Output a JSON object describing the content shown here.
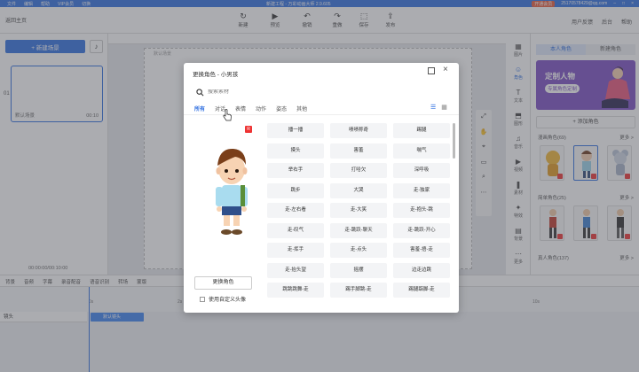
{
  "titlebar": {
    "menu": [
      "文件",
      "编辑",
      "帮助",
      "VIP会员",
      "切换"
    ],
    "title": "新建工程 - 万彩动画大师 2.9.605",
    "vip": "开通会员",
    "account": "25170578429@qq.com"
  },
  "toolbar": {
    "home": "返回主页",
    "buttons": [
      {
        "icon": "↻",
        "label": "新建"
      },
      {
        "icon": "▶",
        "label": "预览"
      },
      {
        "icon": "↶",
        "label": "撤销"
      },
      {
        "icon": "↷",
        "label": "重做"
      },
      {
        "icon": "⬚",
        "label": "保存"
      },
      {
        "icon": "⇪",
        "label": "发布"
      }
    ],
    "right": [
      "用户反馈",
      "后台",
      "帮助"
    ]
  },
  "leftpanel": {
    "new_scene": "+ 新建场景",
    "music_icon": "♪",
    "scene_index": "01",
    "scene_name": "默认场景",
    "scene_duration": "00:10",
    "timecode": "00:00:00/00:10:00"
  },
  "stage": {
    "label": "默认场景"
  },
  "sidetools": [
    "⤢",
    "✋",
    "⌖",
    "▭",
    "⌕",
    "⋯"
  ],
  "rail": [
    {
      "icon": "▦",
      "label": "图片"
    },
    {
      "icon": "☺",
      "label": "角色"
    },
    {
      "icon": "T",
      "label": "文本"
    },
    {
      "icon": "⬒",
      "label": "图形"
    },
    {
      "icon": "♫",
      "label": "音乐"
    },
    {
      "icon": "▶",
      "label": "视频"
    },
    {
      "icon": "❚",
      "label": "素材"
    },
    {
      "icon": "✦",
      "label": "特效"
    },
    {
      "icon": "▤",
      "label": "背景"
    },
    {
      "icon": "⋯",
      "label": "更多"
    }
  ],
  "rightpanel": {
    "tabs": [
      "本人角色",
      "新建角色"
    ],
    "banner_title": "定制人物",
    "banner_sub": "专属角色定制",
    "add_role": "+ 添加角色",
    "section1": "漫画角色(69)",
    "section2": "简单角色(25)",
    "section3": "真人角色(137)",
    "more": "更多 >"
  },
  "timeline": {
    "tools": [
      "背景",
      "音频",
      "字幕",
      "录音配音",
      "语音识别",
      "转场",
      "蒙版"
    ],
    "track_name": "镜头",
    "clip_label": "默认镜头",
    "ruler": [
      "0s",
      "2s",
      "4s",
      "6s",
      "8s",
      "10s"
    ]
  },
  "modal": {
    "title": "更换角色 - 小男孩",
    "search_placeholder": "搜索素材",
    "tabs": [
      "所有",
      "对话",
      "表情",
      "动作",
      "姿态",
      "其他"
    ],
    "badge": "R",
    "replace_button": "更换角色",
    "checkbox_label": "使用自定义头像",
    "actions": [
      "播一播",
      "啧啧称奇",
      "踢腿",
      "摸头",
      "害羞",
      "喘气",
      "举右手",
      "打哈欠",
      "深呼吸",
      "跳步",
      "大哭",
      "走-独家",
      "走-左右看",
      "走-大笑",
      "走-抱头-跳",
      "走-叹气",
      "走-跳跃-聊天",
      "走-跳跃-开心",
      "走-挥手",
      "走-点头",
      "害羞-捂-走",
      "走-抬头望",
      "摇摆",
      "边走边跳",
      "跳跳跳舞-走",
      "踢手脚跳-走",
      "踢腿踮脚-走"
    ]
  }
}
